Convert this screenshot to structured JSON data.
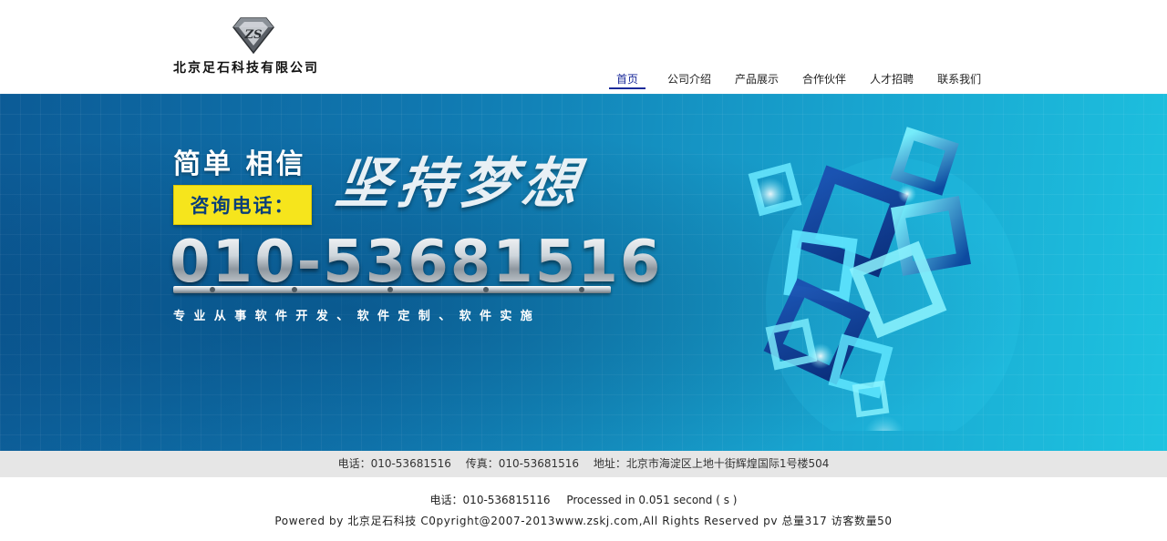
{
  "header": {
    "company_name": "北京足石科技有限公司",
    "logo_icon": "diamond-zs-logo-icon"
  },
  "nav": {
    "items": [
      {
        "label": "首页",
        "active": true
      },
      {
        "label": "公司介绍",
        "active": false
      },
      {
        "label": "产品展示",
        "active": false
      },
      {
        "label": "合作伙伴",
        "active": false
      },
      {
        "label": "人才招聘",
        "active": false
      },
      {
        "label": "联系我们",
        "active": false
      }
    ],
    "active_color": "#1a2a9a"
  },
  "banner": {
    "slogan": "简单 相信",
    "calligraphy": "坚持梦想",
    "consult_label": "咨询电话：",
    "phone": "010-53681516",
    "tagline": "专业从事软件开发、软件定制、软件实施",
    "accent_yellow": "#f6e51c"
  },
  "info": {
    "tel": "电话：010-53681516",
    "fax": "传真：010-53681516",
    "address": "地址：北京市海淀区上地十街辉煌国际1号楼504"
  },
  "footer": {
    "tel": "电话：010-536815116",
    "processed": "Processed in 0.051 second ( s )",
    "copyright": "Powered by 北京足石科技 C0pyright@2007-2013www.zskj.com,All Rights Reserved pv 总量317 访客数量50"
  }
}
